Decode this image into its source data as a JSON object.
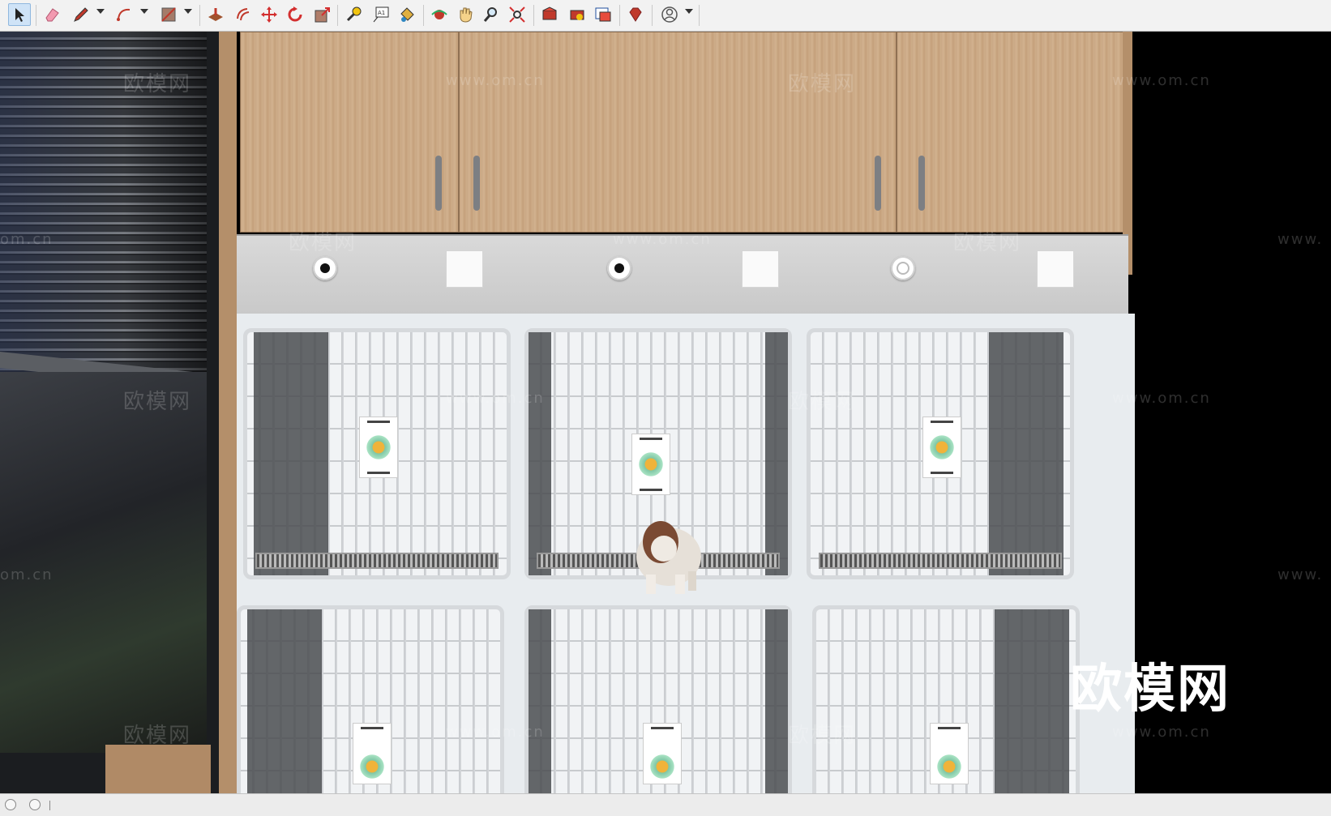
{
  "toolbar": {
    "tools": [
      {
        "name": "select-tool",
        "icon": "select-arrow-icon",
        "active": true
      },
      {
        "name": "eraser-tool",
        "icon": "eraser-icon"
      },
      {
        "name": "line-tool",
        "icon": "pencil-icon",
        "dropdown": true
      },
      {
        "name": "arc-tool",
        "icon": "arc-icon",
        "dropdown": true
      },
      {
        "name": "rectangle-tool",
        "icon": "rectangle-icon",
        "dropdown": true
      },
      {
        "name": "push-pull-tool",
        "icon": "push-pull-icon"
      },
      {
        "name": "offset-tool",
        "icon": "offset-icon"
      },
      {
        "name": "move-tool",
        "icon": "move-icon"
      },
      {
        "name": "rotate-tool",
        "icon": "rotate-icon"
      },
      {
        "name": "scale-tool",
        "icon": "scale-icon"
      },
      {
        "name": "tape-measure-tool",
        "icon": "tape-measure-icon"
      },
      {
        "name": "text-tool",
        "icon": "text-icon",
        "label": "A1"
      },
      {
        "name": "paint-bucket-tool",
        "icon": "paint-bucket-icon"
      },
      {
        "name": "orbit-tool",
        "icon": "orbit-icon"
      },
      {
        "name": "pan-tool",
        "icon": "hand-icon"
      },
      {
        "name": "zoom-tool",
        "icon": "magnifier-icon"
      },
      {
        "name": "zoom-extents-tool",
        "icon": "zoom-extents-icon"
      },
      {
        "name": "warehouse-tool",
        "icon": "warehouse-icon"
      },
      {
        "name": "extension-warehouse-tool",
        "icon": "extension-warehouse-icon"
      },
      {
        "name": "layout-tool",
        "icon": "layout-icon"
      },
      {
        "name": "ruby-console-tool",
        "icon": "ruby-icon"
      },
      {
        "name": "account-tool",
        "icon": "user-icon",
        "dropdown": true
      }
    ]
  },
  "scene": {
    "watermark_cn": "欧模网",
    "watermark_url": "www.om.cn",
    "watermark_partial_left": "om.cn",
    "watermark_partial_right": "www.",
    "brand_logo": "欧模网"
  },
  "status": {
    "text": ""
  },
  "colors": {
    "toolbar_bg": "#f2f2f2",
    "viewport_bg": "#000000",
    "wood": "#c9a784",
    "panel_gray": "#d2d2d2",
    "cage_white": "#f1f3f5"
  }
}
